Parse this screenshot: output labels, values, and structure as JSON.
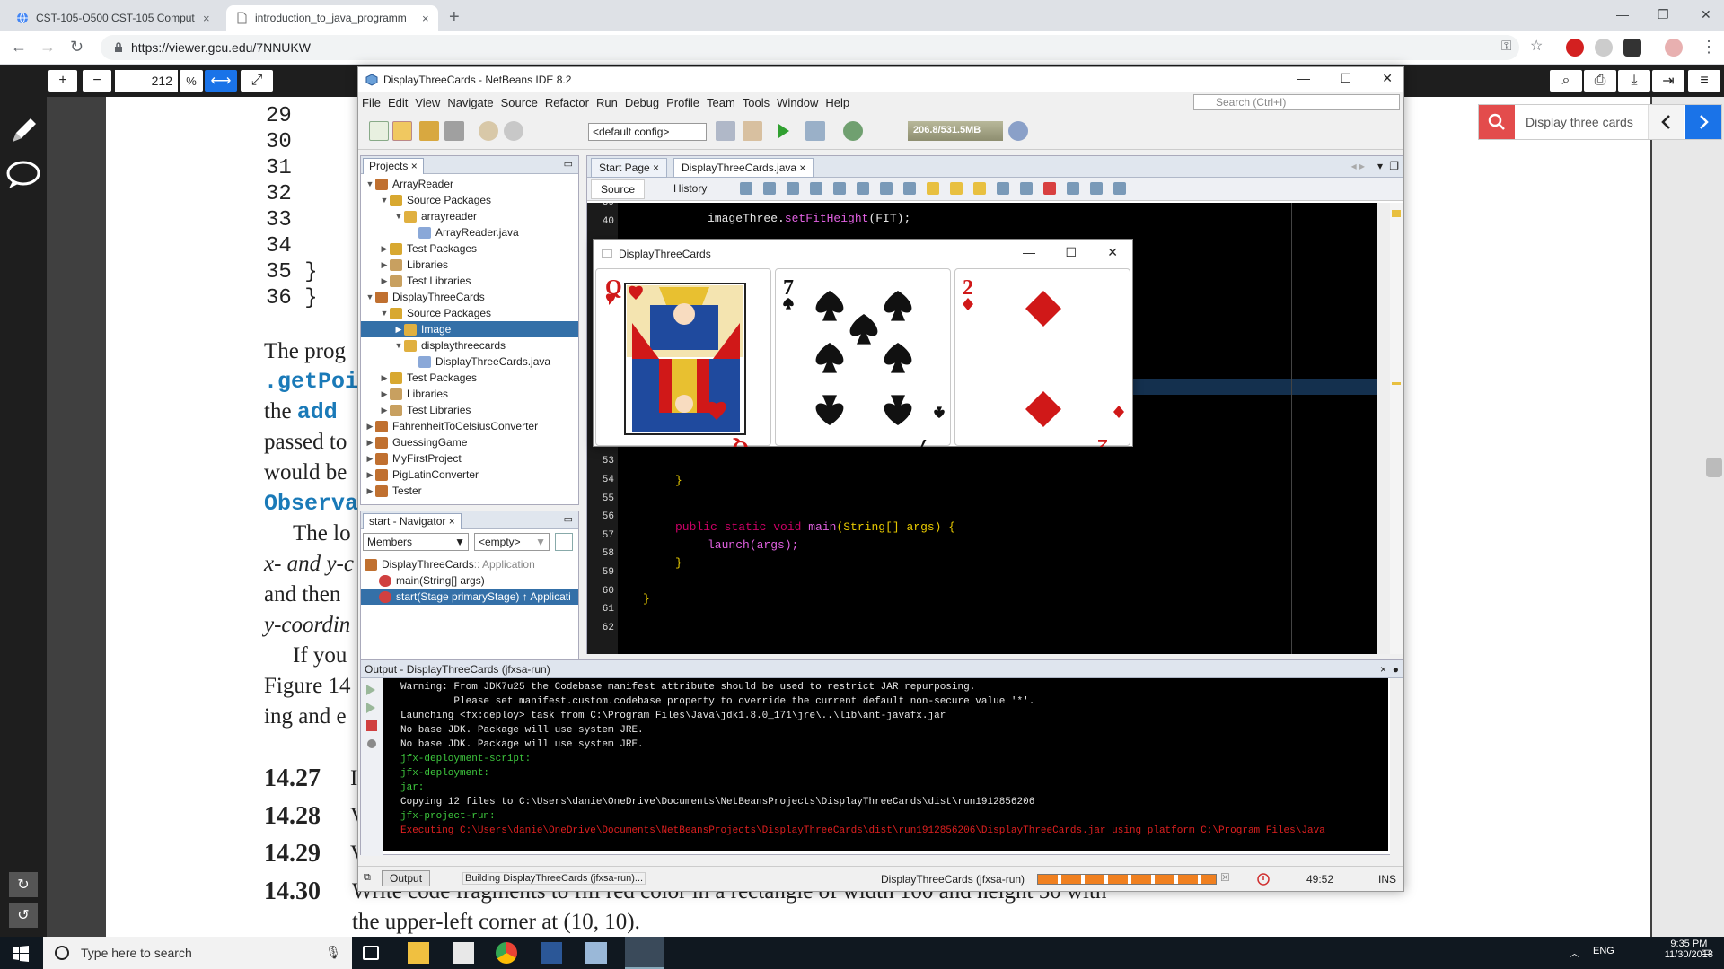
{
  "browser": {
    "tabs": [
      {
        "title": "CST-105-O500 CST-105 Comput",
        "close": "×"
      },
      {
        "title": "introduction_to_java_programm",
        "close": "×"
      }
    ],
    "new_tab": "+",
    "url": "https://viewer.gcu.edu/7NNUKW"
  },
  "viewer": {
    "zoom_value": "212",
    "zoom_unit": "%",
    "zoom_in": "+",
    "zoom_out": "−",
    "find_text": "Display three cards",
    "doc_lines": [
      {
        "text": "29"
      },
      {
        "text": "30"
      },
      {
        "text": "31"
      },
      {
        "text": "32"
      },
      {
        "text": "33"
      },
      {
        "text": "34"
      },
      {
        "text": "35      }"
      },
      {
        "text": "36    }"
      }
    ],
    "prose": {
      "p1": "The prog",
      "p2": ".getPoi",
      "p3a": "the ",
      "p3b": "add",
      "p4": "passed to",
      "p5": "would be",
      "p6": "Observa",
      "p7": "The lo",
      "p8": "x- and y-c",
      "p9": "and then",
      "p10": "y-coordin",
      "p11": "If you",
      "p12": "Figure 14",
      "p13": "ing and e"
    },
    "exercises": [
      {
        "num": "14.27",
        "text": "I"
      },
      {
        "num": "14.28",
        "text": "V"
      },
      {
        "num": "14.29",
        "text": "V"
      },
      {
        "num": "14.30",
        "text": "Write code fragments to fill red color in a rectangle of width 100 and height 50 with"
      }
    ],
    "last_line": "the upper-left corner at (10, 10)."
  },
  "netbeans": {
    "title": "DisplayThreeCards - NetBeans IDE 8.2",
    "menu": [
      "File",
      "Edit",
      "View",
      "Navigate",
      "Source",
      "Refactor",
      "Run",
      "Debug",
      "Profile",
      "Team",
      "Tools",
      "Window",
      "Help"
    ],
    "search_placeholder": "Search (Ctrl+I)",
    "config": "<default config>",
    "memory": "206.8/531.5MB",
    "projects_tab": "Projects",
    "tree": [
      {
        "label": "ArrayReader",
        "indent": 0,
        "arrow": "▼",
        "color": "#c07030"
      },
      {
        "label": "Source Packages",
        "indent": 1,
        "arrow": "▼",
        "color": "#d8a830"
      },
      {
        "label": "arrayreader",
        "indent": 2,
        "arrow": "▼",
        "color": "#e0b040"
      },
      {
        "label": "ArrayReader.java",
        "indent": 3,
        "arrow": "",
        "color": "#8aa8d8"
      },
      {
        "label": "Test Packages",
        "indent": 1,
        "arrow": "▶",
        "color": "#d8a830"
      },
      {
        "label": "Libraries",
        "indent": 1,
        "arrow": "▶",
        "color": "#c8a060"
      },
      {
        "label": "Test Libraries",
        "indent": 1,
        "arrow": "▶",
        "color": "#c8a060"
      },
      {
        "label": "DisplayThreeCards",
        "indent": 0,
        "arrow": "▼",
        "color": "#c07030"
      },
      {
        "label": "Source Packages",
        "indent": 1,
        "arrow": "▼",
        "color": "#d8a830"
      },
      {
        "label": "Image",
        "indent": 2,
        "arrow": "▶",
        "color": "#e0b040",
        "selected": true
      },
      {
        "label": "displaythreecards",
        "indent": 2,
        "arrow": "▼",
        "color": "#e0b040"
      },
      {
        "label": "DisplayThreeCards.java",
        "indent": 3,
        "arrow": "",
        "color": "#8aa8d8"
      },
      {
        "label": "Test Packages",
        "indent": 1,
        "arrow": "▶",
        "color": "#d8a830"
      },
      {
        "label": "Libraries",
        "indent": 1,
        "arrow": "▶",
        "color": "#c8a060"
      },
      {
        "label": "Test Libraries",
        "indent": 1,
        "arrow": "▶",
        "color": "#c8a060"
      },
      {
        "label": "FahrenheitToCelsiusConverter",
        "indent": 0,
        "arrow": "▶",
        "color": "#c07030"
      },
      {
        "label": "GuessingGame",
        "indent": 0,
        "arrow": "▶",
        "color": "#c07030"
      },
      {
        "label": "MyFirstProject",
        "indent": 0,
        "arrow": "▶",
        "color": "#c07030"
      },
      {
        "label": "PigLatinConverter",
        "indent": 0,
        "arrow": "▶",
        "color": "#c07030"
      },
      {
        "label": "Tester",
        "indent": 0,
        "arrow": "▶",
        "color": "#c07030"
      }
    ],
    "navigator_tab": "start - Navigator",
    "nav_members": "Members",
    "nav_empty": "<empty>",
    "nav_items": [
      {
        "label": "DisplayThreeCards",
        "suffix": " :: Application",
        "color": "#c07030"
      },
      {
        "label": "main(String[] args)",
        "suffix": "",
        "color": "#d04040"
      },
      {
        "label": "start(Stage primaryStage) ↑ Applicati",
        "suffix": "",
        "color": "#d04040",
        "selected": true
      }
    ],
    "editor_tabs": [
      "Start Page",
      "DisplayThreeCards.java"
    ],
    "source_btn": "Source",
    "history_btn": "History",
    "line_numbers": [
      "39",
      "40",
      "",
      "",
      "",
      "",
      "",
      "",
      "",
      "",
      "",
      "",
      "",
      "52",
      "53",
      "54",
      "55",
      "56",
      "57",
      "58",
      "59",
      "60",
      "61",
      "62"
    ],
    "code": {
      "l40a": "imageThree.",
      "l40b": "setFitHeight",
      "l40c": "(FIT);",
      "l54": "}",
      "l57kw": "public static void ",
      "l57fn": "main",
      "l57rest": "(String[] args) {",
      "l58": "launch(args);",
      "l59": "}",
      "l61": "}"
    },
    "output_title": "Output - DisplayThreeCards (jfxsa-run)",
    "output_lines": [
      {
        "text": "Warning: From JDK7u25 the Codebase manifest attribute should be used to restrict JAR repurposing.",
        "cls": "ow"
      },
      {
        "text": "         Please set manifest.custom.codebase property to override the current default non-secure value '*'.",
        "cls": "ow"
      },
      {
        "text": "Launching <fx:deploy> task from C:\\Program Files\\Java\\jdk1.8.0_171\\jre\\..\\lib\\ant-javafx.jar",
        "cls": "ow"
      },
      {
        "text": "No base JDK. Package will use system JRE.",
        "cls": "ow"
      },
      {
        "text": "No base JDK. Package will use system JRE.",
        "cls": "ow"
      },
      {
        "text": "jfx-deployment-script:",
        "cls": "og"
      },
      {
        "text": "jfx-deployment:",
        "cls": "og"
      },
      {
        "text": "jar:",
        "cls": "og"
      },
      {
        "text": "Copying 12 files to C:\\Users\\danie\\OneDrive\\Documents\\NetBeansProjects\\DisplayThreeCards\\dist\\run1912856206",
        "cls": "ow"
      },
      {
        "text": "jfx-project-run:",
        "cls": "og"
      },
      {
        "text": "Executing C:\\Users\\danie\\OneDrive\\Documents\\NetBeansProjects\\DisplayThreeCards\\dist\\run1912856206\\DisplayThreeCards.jar using platform C:\\Program Files\\Java",
        "cls": "or"
      }
    ],
    "status": {
      "output_btn": "Output",
      "building": "Building DisplayThreeCards (jfxsa-run)...",
      "task": "DisplayThreeCards (jfxsa-run)",
      "position": "49:52",
      "mode": "INS"
    }
  },
  "fxwindow": {
    "title": "DisplayThreeCards",
    "cards": [
      {
        "rank": "Q",
        "suit": "heart"
      },
      {
        "rank": "7",
        "suit": "spade"
      },
      {
        "rank": "2",
        "suit": "diamond"
      }
    ]
  },
  "taskbar": {
    "search_placeholder": "Type here to search",
    "lang": "ENG",
    "time": "9:35 PM",
    "date": "11/30/2018"
  }
}
